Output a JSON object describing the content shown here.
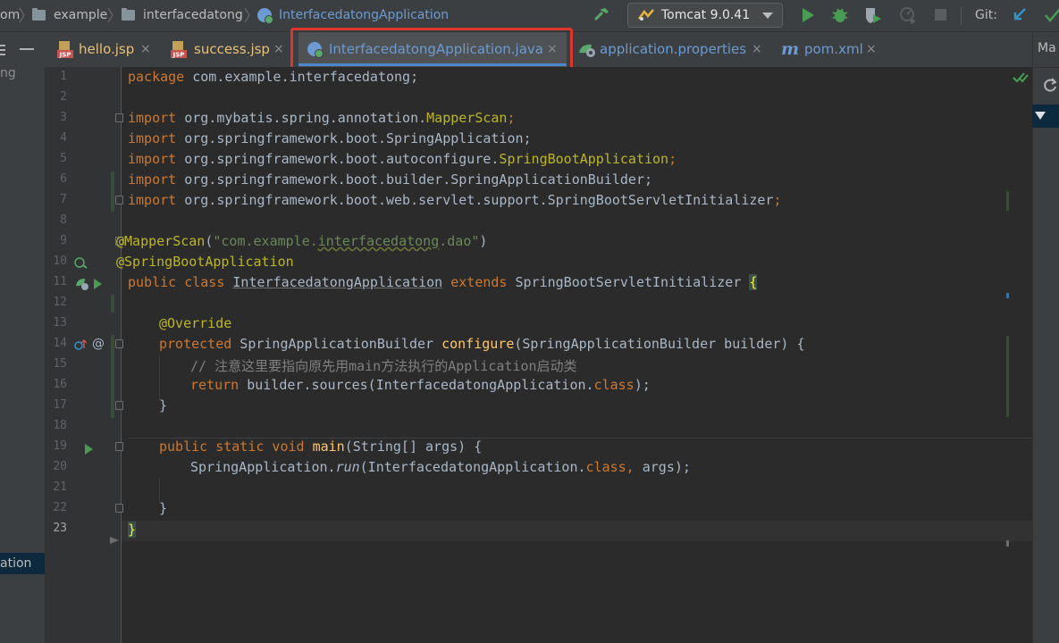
{
  "navbar": {
    "crumb_root_fragment": "om",
    "crumb_1": "example",
    "crumb_2": "interfacedatong",
    "crumb_3": "InterfacedatongApplication",
    "run_config": "Tomcat 9.0.41",
    "git_label": "Git:"
  },
  "tabs": [
    {
      "label": "hello.jsp",
      "icon": "jsp-file-icon"
    },
    {
      "label": "success.jsp",
      "icon": "jsp-file-icon"
    },
    {
      "label": "InterfacedatongApplication.java",
      "icon": "spring-boot-class-icon",
      "active": true
    },
    {
      "label": "application.properties",
      "icon": "spring-properties-icon"
    },
    {
      "label": "pom.xml",
      "icon": "maven-icon"
    }
  ],
  "tab_close_glyph": "×",
  "left_panel": {
    "top_fragment": "ng",
    "selected_fragment": "ation"
  },
  "right_panel": {
    "top_label": "Ma"
  },
  "line_numbers": [
    "1",
    "2",
    "3",
    "4",
    "5",
    "6",
    "7",
    "8",
    "9",
    "10",
    "11",
    "12",
    "13",
    "14",
    "15",
    "16",
    "17",
    "18",
    "19",
    "20",
    "21",
    "22",
    "23"
  ],
  "code": {
    "l1_kw": "package",
    "l1_rest": " com.example.interfacedatong;",
    "l3_kw": "import",
    "l3_pkg": " org.mybatis.spring.annotation.",
    "l3_cls": "MapperScan",
    "l4_kw": "import",
    "l4_rest": " org.springframework.boot.SpringApplication;",
    "l5_kw": "import",
    "l5_pkg": " org.springframework.boot.autoconfigure.",
    "l5_cls": "SpringBootApplication",
    "l6_kw": "import",
    "l6_rest": " org.springframework.boot.builder.SpringApplicationBuilder;",
    "l7_kw": "import",
    "l7_rest": " org.springframework.boot.web.servlet.support.SpringBootServletInitializer",
    "semicolon": ";",
    "l9_ann": "@MapperScan",
    "l9_open": "(",
    "l9_str_a": "\"com.example.",
    "l9_str_b": "interfacedatong",
    "l9_str_c": ".dao\"",
    "l9_close": ")",
    "l10_ann": "@SpringBootApplication",
    "l11_kw": "public class",
    "l11_name": "InterfacedatongApplication",
    "l11_ext": "extends",
    "l11_super": "SpringBootServletInitializer",
    "open_brace": "{",
    "l13_ann": "@Override",
    "l14_kw": "protected",
    "l14_type": " SpringApplicationBuilder ",
    "l14_fn": "configure",
    "l14_params": "(SpringApplicationBuilder builder) {",
    "l15_cmt": "// 注意这里要指向原先用main方法执行的Application启动类",
    "l16_kw": "return",
    "l16_mid": " builder.sources(InterfacedatongApplication.",
    "l16_cls_kw": "class",
    "l16_end": ");",
    "close_brace": "}",
    "l19_kw": "public static void",
    "l19_fn": "main",
    "l19_params": "(String[] args) {",
    "l20_a": "SpringApplication.",
    "l20_run": "run",
    "l20_b": "(InterfacedatongApplication.",
    "l20_cls_kw": "class,",
    "l20_c": " args);",
    "l23_brace": "}"
  },
  "colors": {
    "keyword": "#cc7832",
    "annotation": "#bbb529",
    "string": "#6a8759",
    "comment": "#808080",
    "function": "#ffc66d",
    "text": "#a9b7c6",
    "highlight_box": "#e0352b",
    "active_tab_underline": "#4a88c7"
  }
}
